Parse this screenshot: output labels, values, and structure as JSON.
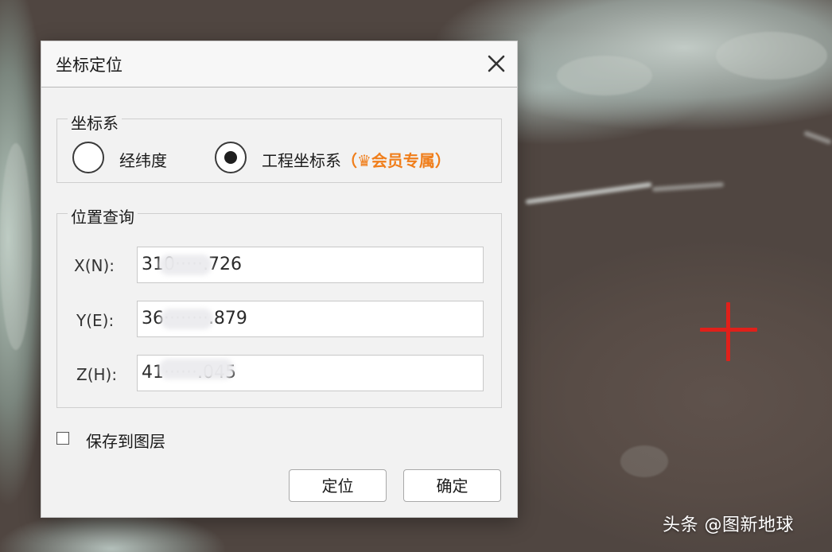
{
  "dialog": {
    "title": "坐标定位",
    "close_icon": "close-icon"
  },
  "coordinate_system": {
    "legend": "坐标系",
    "options": [
      {
        "label": "经纬度",
        "selected": false
      },
      {
        "label": "工程坐标系",
        "badge": "（♛会员专属）",
        "selected": true
      }
    ]
  },
  "position_query": {
    "legend": "位置查询",
    "fields": [
      {
        "label": "X(N):",
        "value": "310·····.726"
      },
      {
        "label": "Y(E):",
        "value": "36········.879"
      },
      {
        "label": "Z(H):",
        "value": "41······.045"
      }
    ]
  },
  "save_to_layer": {
    "label": "保存到图层",
    "checked": false
  },
  "buttons": {
    "locate_label": "定位",
    "confirm_label": "确定"
  },
  "map": {
    "marker_icon": "red-cross-icon",
    "marker_color": "#e0201a"
  },
  "watermark": "头条 @图新地球",
  "colors": {
    "member_accent": "#f07e1b"
  }
}
